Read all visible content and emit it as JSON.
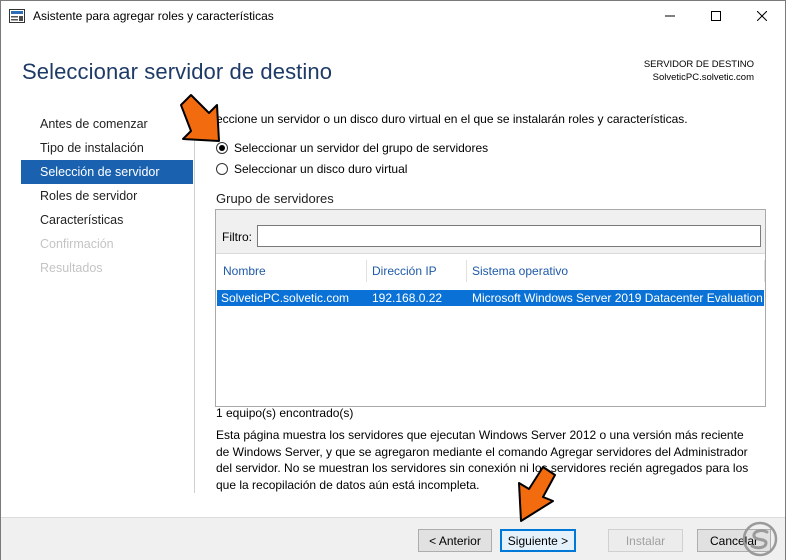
{
  "window": {
    "title": "Asistente para agregar roles y características",
    "minimize_icon": "minimize-icon",
    "maximize_icon": "maximize-icon",
    "close_icon": "close-icon"
  },
  "header": {
    "page_title": "Seleccionar servidor de destino",
    "dest_server_label": "SERVIDOR DE DESTINO",
    "dest_server_name": "SolveticPC.solvetic.com"
  },
  "nav": {
    "items": [
      {
        "label": "Antes de comenzar",
        "state": "normal"
      },
      {
        "label": "Tipo de instalación",
        "state": "normal"
      },
      {
        "label": "Selección de servidor",
        "state": "selected"
      },
      {
        "label": "Roles de servidor",
        "state": "normal"
      },
      {
        "label": "Características",
        "state": "normal"
      },
      {
        "label": "Confirmación",
        "state": "disabled"
      },
      {
        "label": "Resultados",
        "state": "disabled"
      }
    ]
  },
  "main": {
    "intro": "eccione un servidor o un disco duro virtual en el que se instalarán roles y características.",
    "options": [
      {
        "label": "Seleccionar un servidor del grupo de servidores",
        "checked": true
      },
      {
        "label": "Seleccionar un disco duro virtual",
        "checked": false
      }
    ],
    "group_title": "Grupo de servidores",
    "filter_label": "Filtro:",
    "filter_value": "",
    "columns": [
      "Nombre",
      "Dirección IP",
      "Sistema operativo"
    ],
    "rows": [
      {
        "name": "SolveticPC.solvetic.com",
        "ip": "192.168.0.22",
        "os": "Microsoft Windows Server 2019 Datacenter Evaluation",
        "selected": true
      }
    ],
    "found_text": "1 equipo(s) encontrado(s)",
    "description": "Esta página muestra los servidores que ejecutan Windows Server 2012 o una versión más reciente de Windows Server, y que se agregaron mediante el comando Agregar servidores del Administrador del servidor. No se muestran los servidores sin conexión ni los servidores recién agregados para los que la recopilación de datos aún está incompleta."
  },
  "footer": {
    "back_label": "< Anterior",
    "next_label": "Siguiente >",
    "install_label": "Instalar",
    "cancel_label": "Cancelar"
  },
  "colors": {
    "accent": "#1a62b0",
    "selection": "#0a72d6",
    "title": "#1e3a66",
    "arrow": "#f26b0f"
  }
}
